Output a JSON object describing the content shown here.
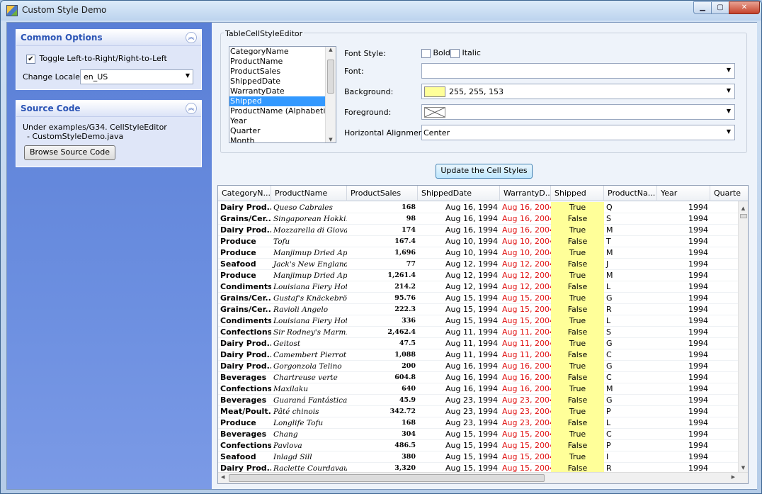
{
  "window": {
    "title": "Custom Style Demo",
    "min_label": "▁",
    "max_label": "▢",
    "close_label": "✕"
  },
  "common_options": {
    "title": "Common Options",
    "toggle_label": "Toggle Left-to-Right/Right-to-Left",
    "toggle_checked": true,
    "locale_label": "Change Locale:",
    "locale_value": "en_US"
  },
  "source_code": {
    "title": "Source Code",
    "line1": "Under examples/G34. CellStyleEditor",
    "line2": "- CustomStyleDemo.java",
    "button": "Browse Source Code"
  },
  "editor": {
    "group_title": "TableCellStyleEditor",
    "columns": [
      "CategoryName",
      "ProductName",
      "ProductSales",
      "ShippedDate",
      "WarrantyDate",
      "Shipped",
      "ProductName (Alphabetical)",
      "Year",
      "Quarter",
      "Month"
    ],
    "selected_column": "Shipped",
    "font_style_label": "Font Style:",
    "bold_label": "Bold",
    "italic_label": "Italic",
    "font_label": "Font:",
    "font_value": "",
    "background_label": "Background:",
    "background_value": "255, 255, 153",
    "background_color": "#ffff99",
    "foreground_label": "Foreground:",
    "alignment_label": "Horizontal Alignment:",
    "alignment_value": "Center",
    "update_button": "Update the Cell Styles"
  },
  "table": {
    "headers": [
      "CategoryN...",
      "ProductName",
      "ProductSales",
      "ShippedDate",
      "WarrantyD...",
      "Shipped",
      "ProductNa...",
      "Year",
      "Quarte"
    ],
    "rows": [
      [
        "Dairy Prod...",
        "Queso Cabrales",
        "168",
        "Aug 16, 1994",
        "Aug 16, 2004",
        "True",
        "Q",
        "1994"
      ],
      [
        "Grains/Cer...",
        "Singaporean Hokki...",
        "98",
        "Aug 16, 1994",
        "Aug 16, 2004",
        "False",
        "S",
        "1994"
      ],
      [
        "Dairy Prod...",
        "Mozzarella di Giovanni",
        "174",
        "Aug 16, 1994",
        "Aug 16, 2004",
        "True",
        "M",
        "1994"
      ],
      [
        "Produce",
        "Tofu",
        "167.4",
        "Aug 10, 1994",
        "Aug 10, 2004",
        "False",
        "T",
        "1994"
      ],
      [
        "Produce",
        "Manjimup Dried Ap...",
        "1,696",
        "Aug 10, 1994",
        "Aug 10, 2004",
        "True",
        "M",
        "1994"
      ],
      [
        "Seafood",
        "Jack's New England...",
        "77",
        "Aug 12, 1994",
        "Aug 12, 2004",
        "False",
        "J",
        "1994"
      ],
      [
        "Produce",
        "Manjimup Dried Ap...",
        "1,261.4",
        "Aug 12, 1994",
        "Aug 12, 2004",
        "True",
        "M",
        "1994"
      ],
      [
        "Condiments",
        "Louisiana Fiery Hot...",
        "214.2",
        "Aug 12, 1994",
        "Aug 12, 2004",
        "False",
        "L",
        "1994"
      ],
      [
        "Grains/Cer...",
        "Gustaf's Knäckebröd",
        "95.76",
        "Aug 15, 1994",
        "Aug 15, 2004",
        "True",
        "G",
        "1994"
      ],
      [
        "Grains/Cer...",
        "Ravioli Angelo",
        "222.3",
        "Aug 15, 1994",
        "Aug 15, 2004",
        "False",
        "R",
        "1994"
      ],
      [
        "Condiments",
        "Louisiana Fiery Hot...",
        "336",
        "Aug 15, 1994",
        "Aug 15, 2004",
        "True",
        "L",
        "1994"
      ],
      [
        "Confections",
        "Sir Rodney's Marm...",
        "2,462.4",
        "Aug 11, 1994",
        "Aug 11, 2004",
        "False",
        "S",
        "1994"
      ],
      [
        "Dairy Prod...",
        "Geitost",
        "47.5",
        "Aug 11, 1994",
        "Aug 11, 2004",
        "True",
        "G",
        "1994"
      ],
      [
        "Dairy Prod...",
        "Camembert Pierrot",
        "1,088",
        "Aug 11, 1994",
        "Aug 11, 2004",
        "False",
        "C",
        "1994"
      ],
      [
        "Dairy Prod...",
        "Gorgonzola Telino",
        "200",
        "Aug 16, 1994",
        "Aug 16, 2004",
        "True",
        "G",
        "1994"
      ],
      [
        "Beverages",
        "Chartreuse verte",
        "604.8",
        "Aug 16, 1994",
        "Aug 16, 2004",
        "False",
        "C",
        "1994"
      ],
      [
        "Confections",
        "Maxilaku",
        "640",
        "Aug 16, 1994",
        "Aug 16, 2004",
        "True",
        "M",
        "1994"
      ],
      [
        "Beverages",
        "Guaraná Fantástica",
        "45.9",
        "Aug 23, 1994",
        "Aug 23, 2004",
        "False",
        "G",
        "1994"
      ],
      [
        "Meat/Poult...",
        "Pâté chinois",
        "342.72",
        "Aug 23, 1994",
        "Aug 23, 2004",
        "True",
        "P",
        "1994"
      ],
      [
        "Produce",
        "Longlife Tofu",
        "168",
        "Aug 23, 1994",
        "Aug 23, 2004",
        "False",
        "L",
        "1994"
      ],
      [
        "Beverages",
        "Chang",
        "304",
        "Aug 15, 1994",
        "Aug 15, 2004",
        "True",
        "C",
        "1994"
      ],
      [
        "Confections",
        "Pavlova",
        "486.5",
        "Aug 15, 1994",
        "Aug 15, 2004",
        "False",
        "P",
        "1994"
      ],
      [
        "Seafood",
        "Inlagd Sill",
        "380",
        "Aug 15, 1994",
        "Aug 15, 2004",
        "True",
        "I",
        "1994"
      ],
      [
        "Dairy Prod...",
        "Raclette Courdavault",
        "3,320",
        "Aug 15, 1994",
        "Aug 15, 2004",
        "False",
        "R",
        "1994"
      ]
    ]
  }
}
